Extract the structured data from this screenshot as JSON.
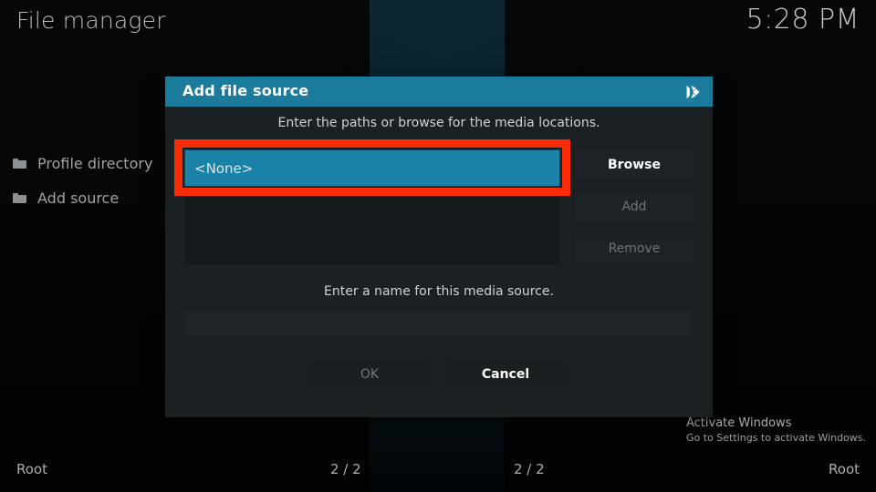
{
  "app": {
    "title": "File manager",
    "clock": "5:28 PM"
  },
  "sidebar": {
    "items": [
      {
        "label": "Profile directory",
        "icon": "folder-icon"
      },
      {
        "label": "Add source",
        "icon": "folder-icon"
      }
    ]
  },
  "dialog": {
    "title": "Add file source",
    "logo_icon": "kodi-logo-icon",
    "hint_paths": "Enter the paths or browse for the media locations.",
    "hint_name": "Enter a name for this media source.",
    "paths": {
      "selected_value": "<None>",
      "items": [
        "<None>"
      ]
    },
    "name_input": {
      "value": "",
      "placeholder": ""
    },
    "side_buttons": [
      {
        "label": "Browse",
        "enabled": true
      },
      {
        "label": "Add",
        "enabled": false
      },
      {
        "label": "Remove",
        "enabled": false
      }
    ],
    "actions": [
      {
        "label": "OK",
        "enabled": false
      },
      {
        "label": "Cancel",
        "enabled": true
      }
    ]
  },
  "statusbar": {
    "left": "Root",
    "mid_left": "2 / 2",
    "mid_right": "2 / 2",
    "right": "Root"
  },
  "watermark": {
    "title": "Activate Windows",
    "subtitle": "Go to Settings to activate Windows."
  },
  "colors": {
    "accent_teal": "#1a7b9c",
    "selection_teal": "#1a82a6",
    "highlight_red": "#fa2d07",
    "dialog_bg": "#1b2023",
    "page_bg": "#050506"
  }
}
